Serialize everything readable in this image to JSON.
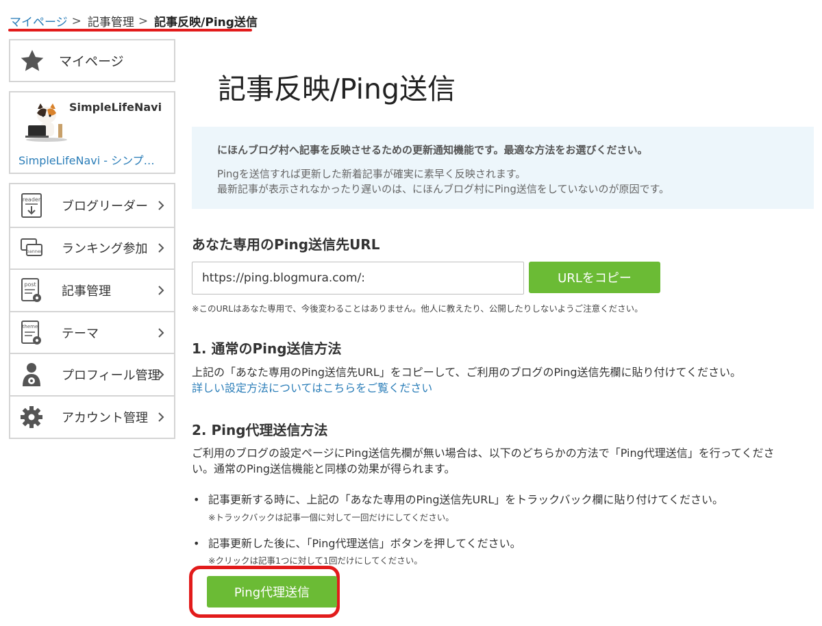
{
  "breadcrumb": {
    "home": "マイページ",
    "sep": ">",
    "middle": "記事管理",
    "current": "記事反映/Ping送信"
  },
  "sidebar": {
    "mypage_label": "マイページ",
    "profile": {
      "name": "SimpleLifeNavi",
      "blog_title": "SimpleLifeNavi - シンプ…"
    },
    "items": [
      {
        "label": "ブログリーダー",
        "icon": "reader-icon",
        "icon_text": "reader"
      },
      {
        "label": "ランキング参加",
        "icon": "banner-icon",
        "icon_text": "banner"
      },
      {
        "label": "記事管理",
        "icon": "post-icon",
        "icon_text": "post"
      },
      {
        "label": "テーマ",
        "icon": "theme-icon",
        "icon_text": "theme"
      },
      {
        "label": "プロフィール管理",
        "icon": "profile-icon",
        "icon_text": ""
      },
      {
        "label": "アカウント管理",
        "icon": "gear-icon",
        "icon_text": ""
      }
    ]
  },
  "main": {
    "title": "記事反映/Ping送信",
    "info": {
      "headline": "にほんブログ村へ記事を反映させるための更新通知機能です。最適な方法をお選びください。",
      "line1": "Pingを送信すれば更新した新着記事が確実に素早く反映されます。",
      "line2": "最新記事が表示されなかったり遅いのは、にほんブログ村にPing送信をしていないのが原因です。"
    },
    "url_section": {
      "title": "あなた専用のPing送信先URL",
      "url_value": "https://ping.blogmura.com/:",
      "copy_button": "URLをコピー",
      "note": "※このURLはあなた専用で、今後変わることはありません。他人に教えたり、公開したりしないようご注意ください。"
    },
    "normal_section": {
      "title": "1. 通常のPing送信方法",
      "text": "上記の「あなた専用のPing送信先URL」をコピーして、ご利用のブログのPing送信先欄に貼り付けてください。",
      "link": "詳しい設定方法についてはこちらをご覧ください"
    },
    "proxy_section": {
      "title": "2. Ping代理送信方法",
      "text_line1": "ご利用のブログの設定ページにPing送信先欄が無い場合は、以下のどちらかの方法で「Ping代理送信」を行ってくださ",
      "text_line2": "い。通常のPing送信機能と同様の効果が得られます。",
      "bullets": [
        {
          "text": "記事更新する時に、上記の「あなた専用のPing送信先URL」をトラックバック欄に貼り付けてください。",
          "note": "※トラックバックは記事一個に対して一回だけにしてください。"
        },
        {
          "text": "記事更新した後に、「Ping代理送信」ボタンを押してください。",
          "note": "※クリックは記事1つに対して1回だけにしてください。"
        }
      ],
      "button": "Ping代理送信"
    }
  },
  "colors": {
    "accent_green": "#6bbb35",
    "link_blue": "#2a7db8",
    "highlight_red": "#e21b1b",
    "info_bg": "#edf6fb"
  }
}
